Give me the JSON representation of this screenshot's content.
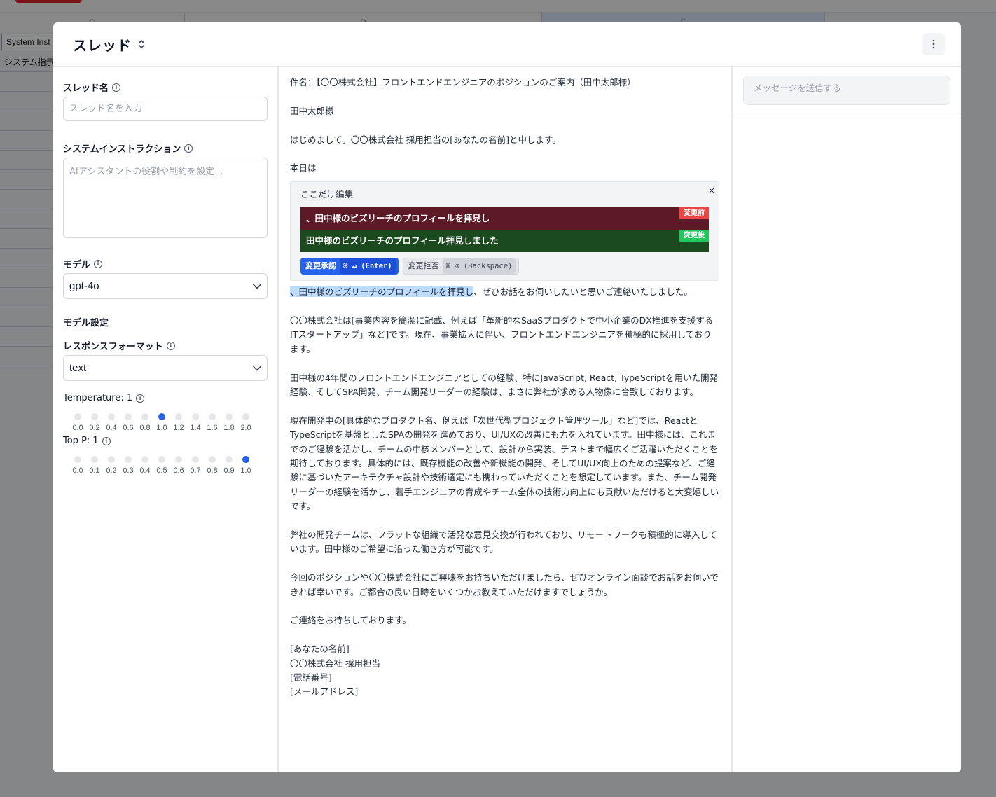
{
  "background": {
    "col_c": "C",
    "col_d": "D",
    "col_e": "E",
    "cell_button": "System Inst",
    "cell_text": "システム指示"
  },
  "header": {
    "title": "スレッド",
    "more_label": "⋮"
  },
  "left": {
    "thread_name_label": "スレッド名",
    "thread_name_placeholder": "スレッド名を入力",
    "system_label": "システムインストラクション",
    "system_placeholder": "AIアシスタントの役割や制約を設定...",
    "model_label": "モデル",
    "model_value": "gpt-4o",
    "model_settings_label": "モデル設定",
    "response_format_label": "レスポンスフォーマット",
    "response_format_value": "text",
    "temperature_label": "Temperature: 1",
    "temperature_ticks": [
      "0.0",
      "0.2",
      "0.4",
      "0.6",
      "0.8",
      "1.0",
      "1.2",
      "1.4",
      "1.6",
      "1.8",
      "2.0"
    ],
    "temperature_value": 1.0,
    "top_p_label": "Top P: 1",
    "top_p_ticks": [
      "0.0",
      "0.1",
      "0.2",
      "0.3",
      "0.4",
      "0.5",
      "0.6",
      "0.7",
      "0.8",
      "0.9",
      "1.0"
    ],
    "top_p_value": 1.0
  },
  "email": {
    "subject": "件名：【〇〇株式会社】フロントエンドエンジニアのポジションのご案内（田中太郎様）",
    "greeting": "田中太郎様",
    "intro": "はじめまして。〇〇株式会社 採用担当の[あなたの名前]と申します。",
    "today": "本日は",
    "edit": {
      "title": "ここだけ編集",
      "close": "×",
      "before_text": "、田中様のビズリーチのプロフィールを拝見し",
      "before_badge": "変更前",
      "after_text": "田中様のビズリーチのプロフィール拝見しました",
      "after_badge": "変更後",
      "accept_label": "変更承認",
      "accept_kbd": "⌘ ↵ (Enter)",
      "reject_label": "変更拒否",
      "reject_kbd": "⌘ ⌫ (Backspace)"
    },
    "highlight_text": "、田中様のビズリーチのプロフィールを拝見し",
    "after_highlight": "、ぜひお話をお伺いしたいと思いご連絡いたしました。",
    "p_company": "〇〇株式会社は[事業内容を簡潔に記載、例えば「革新的なSaaSプロダクトで中小企業のDX推進を支援するITスタートアップ」など]です。現在、事業拡大に伴い、フロントエンドエンジニアを積極的に採用しております。",
    "p_experience": "田中様の4年間のフロントエンドエンジニアとしての経験、特にJavaScript, React, TypeScriptを用いた開発経験、そしてSPA開発、チーム開発リーダーの経験は、まさに弊社が求める人物像に合致しております。",
    "p_product": "現在開発中の[具体的なプロダクト名、例えば「次世代型プロジェクト管理ツール」など]では、ReactとTypeScriptを基盤としたSPAの開発を進めており、UI/UXの改善にも力を入れています。田中様には、これまでのご経験を活かし、チームの中核メンバーとして、設計から実装、テストまで幅広くご活躍いただくことを期待しております。具体的には、既存機能の改善や新機能の開発、そしてUI/UX向上のための提案など、ご経験に基づいたアーキテクチャ設計や技術選定にも携わっていただくことを想定しています。また、チーム開発リーダーの経験を活かし、若手エンジニアの育成やチーム全体の技術力向上にも貢献いただけると大変嬉しいです。",
    "p_team": "弊社の開発チームは、フラットな組織で活発な意見交換が行われており、リモートワークも積極的に導入しています。田中様のご希望に沿った働き方が可能です。",
    "p_interest": "今回のポジションや〇〇株式会社にご興味をお持ちいただけましたら、ぜひオンライン面談でお話をお伺いできれば幸いです。ご都合の良い日時をいくつかお教えていただけますでしょうか。",
    "p_closing": "ご連絡をお待ちしております。",
    "sig_name": "[あなたの名前]",
    "sig_company": "〇〇株式会社 採用担当",
    "sig_phone": "[電話番号]",
    "sig_email": "[メールアドレス]"
  },
  "chat": {
    "placeholder": "メッセージを送信する"
  }
}
